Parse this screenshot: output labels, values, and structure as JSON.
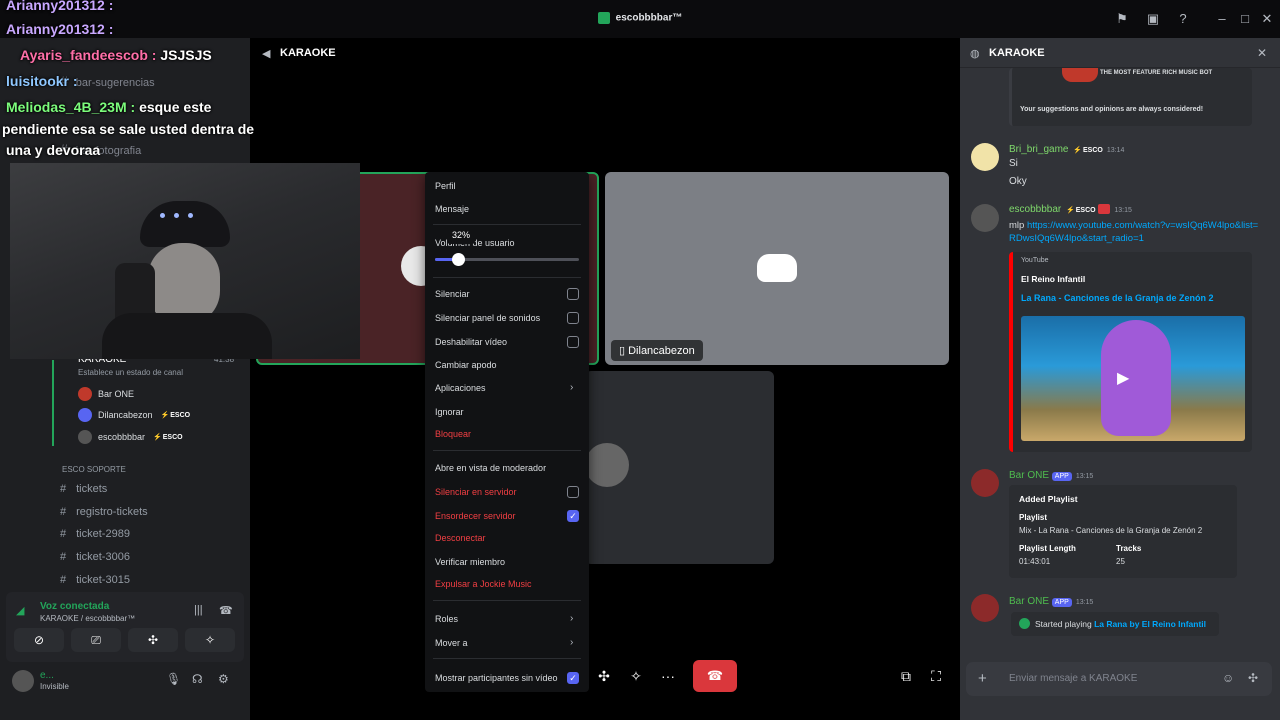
{
  "window": {
    "title": "escobbbbar™"
  },
  "overlay_chat": [
    {
      "user": "Arianny201312 :",
      "text": ""
    },
    {
      "user": "Arianny201312 :",
      "text": ""
    },
    {
      "user": "Ayaris_fandeescob :",
      "text": "JSJSJS"
    },
    {
      "user": "luisitookr :",
      "text": ""
    },
    {
      "user": "Meliodas_4B_23M :",
      "text": "esque este"
    },
    {
      "user": "",
      "text": "pendiente esa se sale usted dentra de"
    },
    {
      "user": "",
      "text": "una y devoraa"
    }
  ],
  "sidebar": {
    "channels_top": [
      "bar-sugerencias",
      "bar-fotografia"
    ],
    "voice_channel": {
      "name": "KARAOKE",
      "time": "41:38",
      "status": "Establece un estado de canal"
    },
    "voice_users": [
      {
        "name": "Bar ONE",
        "tag": ""
      },
      {
        "name": "Dilancabezon",
        "tag": "ESCO"
      },
      {
        "name": "escobbbbar",
        "tag": "ESCO"
      }
    ],
    "category": "ESCO SOPORTE",
    "channels": [
      "tickets",
      "registro-tickets",
      "ticket-2989",
      "ticket-3006",
      "ticket-3015"
    ],
    "voice_status": {
      "title": "Voz conectada",
      "sub": "KARAOKE / escobbbbar™"
    },
    "user": {
      "name": "e...",
      "status": "Invisible"
    }
  },
  "main": {
    "title": "KARAOKE",
    "tile_label": "Dilancabezon"
  },
  "context_menu": {
    "items_top": [
      "Perfil",
      "Mensaje"
    ],
    "volume_label": "Volumen de usuario",
    "volume_tooltip": "32%",
    "volume_level": 0.16,
    "items_check": [
      {
        "label": "Silenciar",
        "checked": false
      },
      {
        "label": "Silenciar panel de sonidos",
        "checked": false
      },
      {
        "label": "Deshabilitar vídeo",
        "checked": false
      }
    ],
    "cambiar_apodo": "Cambiar apodo",
    "aplicaciones": "Aplicaciones",
    "ignorar": "Ignorar",
    "bloquear": "Bloquear",
    "abrir_moderador": "Abre en vista de moderador",
    "silenciar_servidor": "Silenciar en servidor",
    "ensordecer_servidor": "Ensordecer servidor",
    "desconectar": "Desconectar",
    "verificar": "Verificar miembro",
    "expulsar": "Expulsar a Jockie Music",
    "roles": "Roles",
    "mover": "Mover a",
    "mostrar": "Mostrar participantes sin vídeo"
  },
  "right_panel": {
    "title": "KARAOKE",
    "top_embed": {
      "tagline": "THE MOST FEATURE RICH MUSIC BOT",
      "note": "Your suggestions and opinions are always considered!"
    },
    "messages": [
      {
        "name": "Bri_bri_game",
        "tag": "ESCO",
        "time": "13:14",
        "lines": [
          "Si",
          "Oky"
        ],
        "color": "#7fd96b"
      },
      {
        "name": "escobbbbar",
        "tag": "ESCO",
        "time": "13:15",
        "lines": [
          "mlp"
        ],
        "color": "#7fd96b",
        "link": "https://www.youtube.com/watch?v=wsIQq6W4lpo&list=RDwsIQq6W4lpo&start_radio=1"
      }
    ],
    "yt_embed": {
      "provider": "YouTube",
      "author": "El Reino Infantil",
      "title": "La Rana - Canciones de la Granja de Zenón 2"
    },
    "playlist_msg": {
      "name": "Bar ONE",
      "app": "APP",
      "time": "13:15",
      "heading": "Added Playlist",
      "playlist_label": "Playlist",
      "playlist_value": "Mix - La Rana - Canciones de la Granja de Zenón 2",
      "length_label": "Playlist Length",
      "length_value": "01:43:01",
      "tracks_label": "Tracks",
      "tracks_value": "25"
    },
    "playing_msg": {
      "name": "Bar ONE",
      "app": "APP",
      "time": "13:15",
      "prefix": "Started playing",
      "track": "La Rana by El Reino Infantil"
    },
    "input_placeholder": "Enviar mensaje a KARAOKE"
  }
}
